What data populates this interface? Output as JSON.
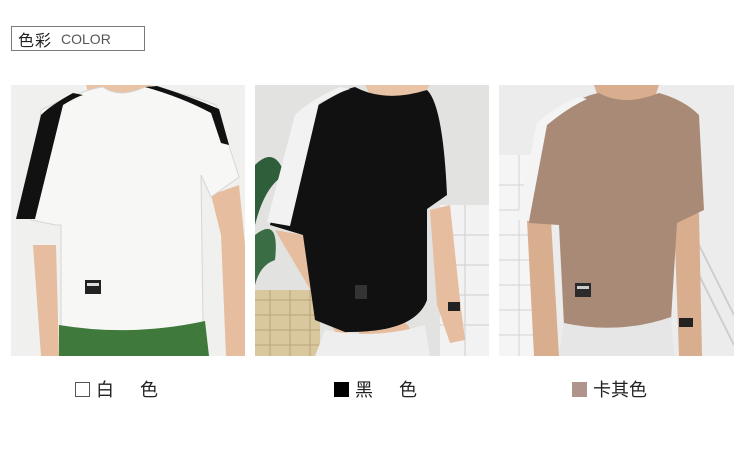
{
  "header": {
    "title_cn": "色彩",
    "title_en": "COLOR"
  },
  "products": [
    {
      "label_a": "白",
      "label_b": "色",
      "label": "白　色",
      "swatch_color": "#ffffff",
      "shirt_color": "#f7f7f5",
      "stripe_color": "#111111",
      "image": "model wearing white t-shirt with black shoulder stripe"
    },
    {
      "label_a": "黑",
      "label_b": "色",
      "label": "黑　色",
      "swatch_color": "#000000",
      "shirt_color": "#111111",
      "stripe_color": "#f2f2f2",
      "image": "model wearing black t-shirt with white shoulder stripe"
    },
    {
      "label_a": "卡其色",
      "label_b": "",
      "label": "卡其色",
      "swatch_color": "#b0948b",
      "shirt_color": "#a88a77",
      "stripe_color": "#f4f4f4",
      "image": "model wearing khaki t-shirt with white shoulder stripe"
    }
  ]
}
